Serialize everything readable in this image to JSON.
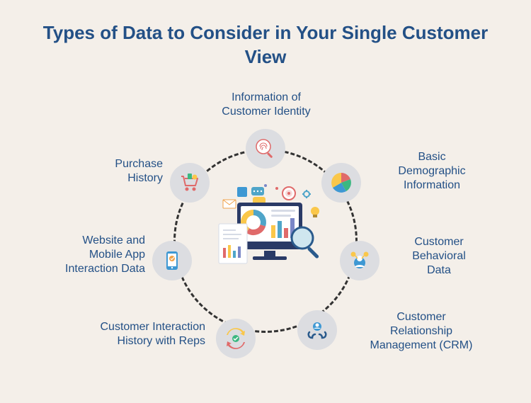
{
  "title": "Types of Data to Consider in Your Single Customer View",
  "colors": {
    "background": "#f4efe9",
    "headline": "#235086",
    "node_bg": "#dcdde1",
    "ring": "#333333"
  },
  "center_icon": "monitor-analytics-icon",
  "nodes": [
    {
      "id": "customer-identity",
      "label": "Information of\nCustomer Identity",
      "icon": "fingerprint-search-icon"
    },
    {
      "id": "basic-demographic",
      "label": "Basic\nDemographic\nInformation",
      "icon": "pie-chart-icon"
    },
    {
      "id": "behavioral-data",
      "label": "Customer\nBehavioral\nData",
      "icon": "user-behavior-icon"
    },
    {
      "id": "crm",
      "label": "Customer\nRelationship\nManagement (CRM)",
      "icon": "hands-customer-icon"
    },
    {
      "id": "interaction-reps",
      "label": "Customer Interaction\nHistory with Reps",
      "icon": "sync-people-icon"
    },
    {
      "id": "web-mobile",
      "label": "Website and\nMobile App\nInteraction Data",
      "icon": "mobile-app-icon"
    },
    {
      "id": "purchase-history",
      "label": "Purchase\nHistory",
      "icon": "shopping-cart-icon"
    }
  ]
}
